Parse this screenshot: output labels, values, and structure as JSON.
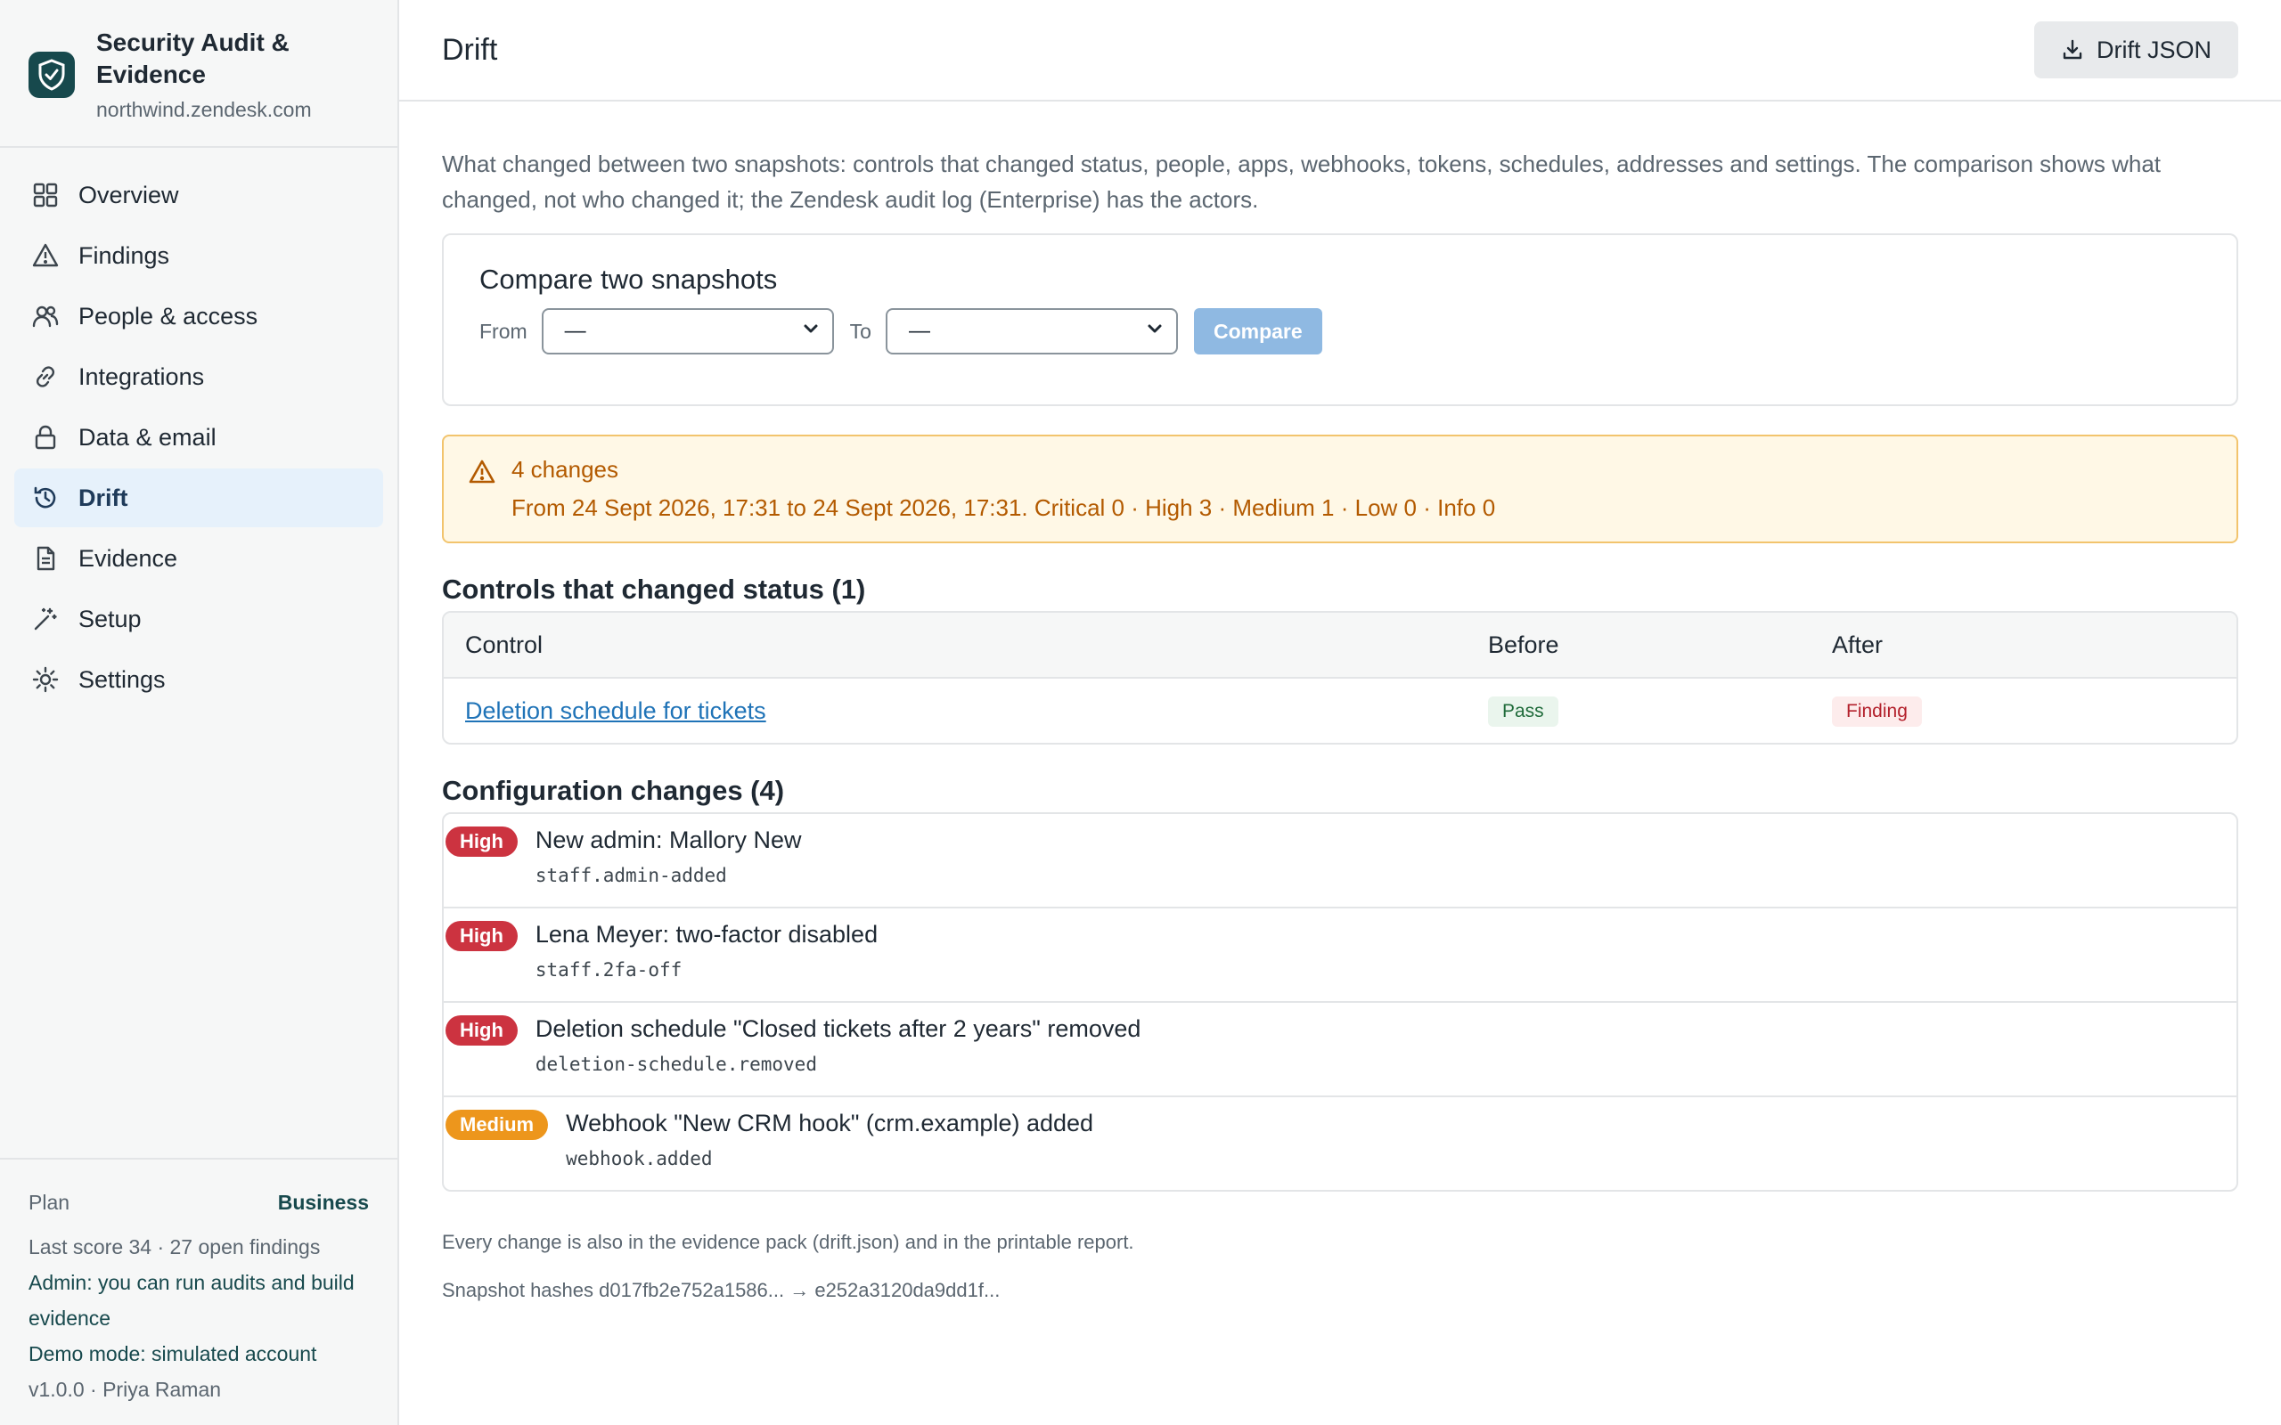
{
  "brand": {
    "title": "Security Audit & Evidence",
    "subdomain": "northwind.zendesk.com"
  },
  "nav": {
    "items": [
      {
        "label": "Overview",
        "icon": "grid-icon"
      },
      {
        "label": "Findings",
        "icon": "warning-icon"
      },
      {
        "label": "People & access",
        "icon": "people-icon"
      },
      {
        "label": "Integrations",
        "icon": "link-icon"
      },
      {
        "label": "Data & email",
        "icon": "lock-icon"
      },
      {
        "label": "Drift",
        "icon": "history-icon",
        "active": true
      },
      {
        "label": "Evidence",
        "icon": "document-icon"
      },
      {
        "label": "Setup",
        "icon": "wand-icon"
      },
      {
        "label": "Settings",
        "icon": "gear-icon"
      }
    ]
  },
  "sidebar_footer": {
    "plan_label": "Plan",
    "plan_value": "Business",
    "score_line": "Last score 34 · 27 open findings",
    "admin_note": "Admin: you can run audits and build evidence",
    "demo_note": "Demo mode: simulated account",
    "version_line": "v1.0.0 · Priya Raman"
  },
  "header": {
    "title": "Drift",
    "json_button": "Drift JSON"
  },
  "intro": "What changed between two snapshots: controls that changed status, people, apps, webhooks, tokens, schedules, addresses and settings. The comparison shows what changed, not who changed it; the Zendesk audit log (Enterprise) has the actors.",
  "compare": {
    "title": "Compare two snapshots",
    "from_label": "From",
    "from_value": "—",
    "to_label": "To",
    "to_value": "—",
    "button": "Compare"
  },
  "alert": {
    "title": "4 changes",
    "text": "From 24 Sept 2026, 17:31 to 24 Sept 2026, 17:31. Critical 0 · High 3 · Medium 1 · Low 0 · Info 0"
  },
  "controls": {
    "title": "Controls that changed status (1)",
    "headers": [
      "Control",
      "Before",
      "After"
    ],
    "rows": [
      {
        "control": "Deletion schedule for tickets",
        "before": "Pass",
        "after": "Finding"
      }
    ]
  },
  "config": {
    "title": "Configuration changes (4)",
    "items": [
      {
        "severity": "High",
        "title": "New admin: Mallory New",
        "code": "staff.admin-added"
      },
      {
        "severity": "High",
        "title": "Lena Meyer: two-factor disabled",
        "code": "staff.2fa-off"
      },
      {
        "severity": "High",
        "title": "Deletion schedule \"Closed tickets after 2 years\" removed",
        "code": "deletion-schedule.removed"
      },
      {
        "severity": "Medium",
        "title": "Webhook \"New CRM hook\" (crm.example) added",
        "code": "webhook.added"
      }
    ]
  },
  "footnote": "Every change is also in the evidence pack (drift.json) and in the printable report.",
  "hashes": "Snapshot hashes d017fb2e752a1586... → e252a3120da9dd1f..."
}
